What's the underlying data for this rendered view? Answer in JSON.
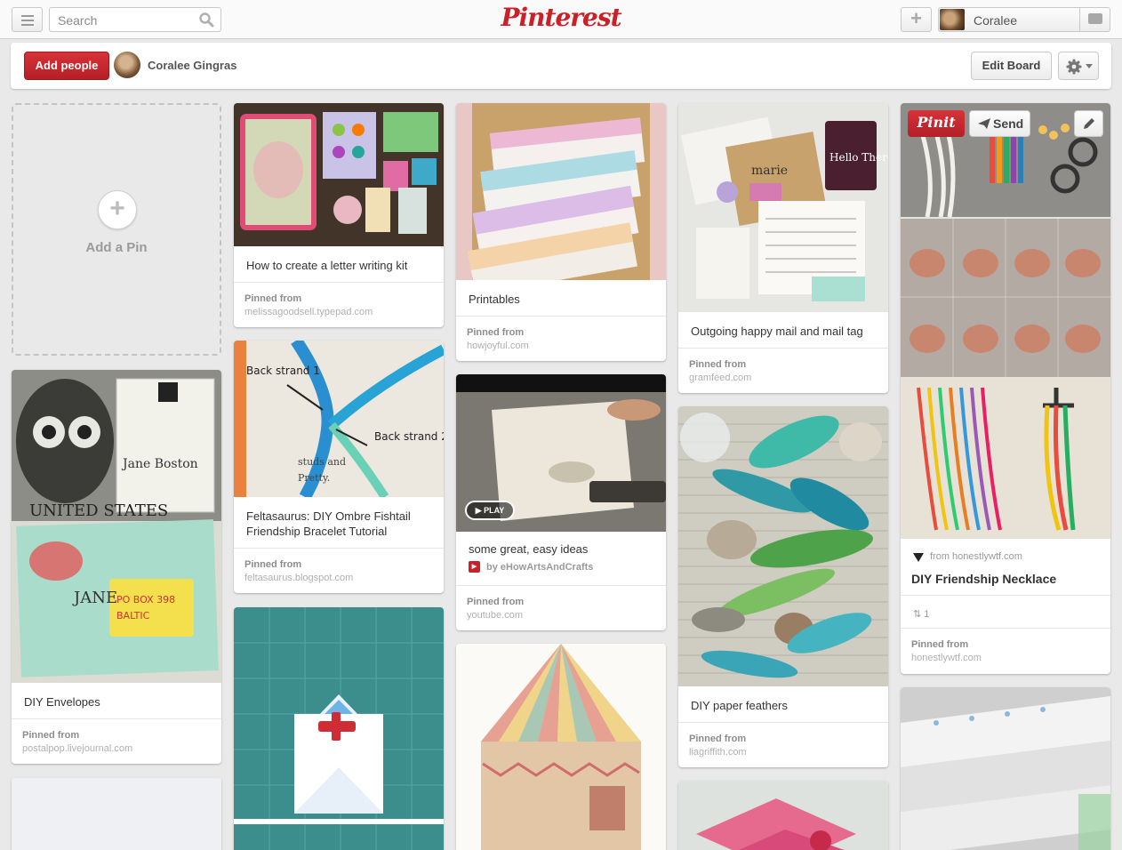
{
  "header": {
    "search_placeholder": "Search",
    "logo_text": "Pinterest",
    "user_name": "Coralee",
    "brand_color": "#cb2027"
  },
  "board_bar": {
    "add_people_label": "Add people",
    "owner_name": "Coralee Gingras",
    "edit_board_label": "Edit Board"
  },
  "add_pin": {
    "label": "Add a Pin"
  },
  "pinned_from_label": "Pinned from",
  "pins": {
    "letter_kit": {
      "description": "How to create a letter writing kit",
      "source": "melissagoodsell.typepad.com"
    },
    "printables": {
      "description": "Printables",
      "source": "howjoyful.com"
    },
    "happy_mail": {
      "description": "Outgoing happy mail and mail tag",
      "source": "gramfeed.com"
    },
    "diy_envelopes": {
      "description": "DIY Envelopes",
      "source": "postalpop.livejournal.com"
    },
    "feltasaurus": {
      "description": "Feltasaurus: DIY Ombre Fishtail Friendship Bracelet Tutorial",
      "source": "feltasaurus.blogspot.com"
    },
    "easy_ideas": {
      "description": "some great, easy ideas",
      "byline": "by eHowArtsAndCrafts",
      "source": "youtube.com",
      "play_label": "PLAY"
    },
    "paper_feathers": {
      "description": "DIY paper feathers",
      "source": "liagriffith.com"
    },
    "friendship_necklace": {
      "from_site": "from honestlywtf.com",
      "title": "DIY Friendship Necklace",
      "repin_count": "1",
      "source": "honestlywtf.com",
      "pinit_label": "Pinit",
      "send_label": "Send"
    }
  },
  "icons": [
    "menu-icon",
    "search-icon",
    "plus-icon",
    "message-icon",
    "gear-icon",
    "chevron-down-icon",
    "plus-circle-icon",
    "play-icon",
    "youtube-icon",
    "send-icon",
    "pencil-icon",
    "repin-icon"
  ]
}
